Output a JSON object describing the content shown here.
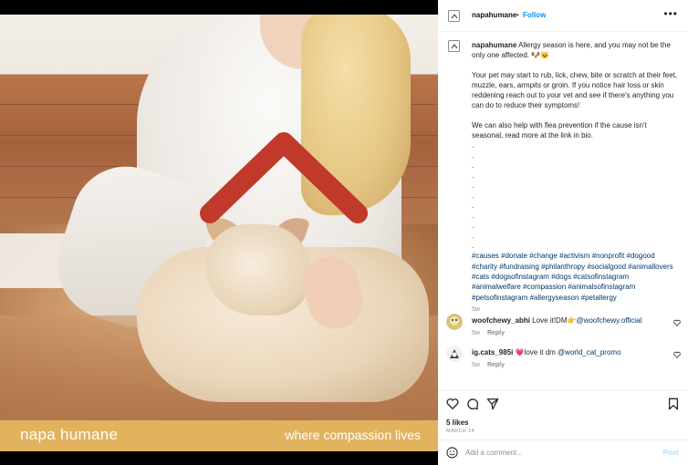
{
  "post_image": {
    "brand": "napa humane",
    "tagline": "where compassion lives"
  },
  "header": {
    "username": "napahumane",
    "separator": "•",
    "follow_label": "Follow",
    "more_label": "•••"
  },
  "caption": {
    "username": "napahumane",
    "text1": "Allergy season is here, and you may not be the only one affected. 🐶🐱",
    "text2": "Your pet may start to rub, lick, chew, bite or scratch at their feet, muzzle, ears, armpits or groin. If you notice hair loss or skin reddening reach out to your vet and see if there's anything you can do to reduce their symptoms!",
    "text3": "We can also help with flea prevention if the cause isn't seasonal, read more at the link in bio.",
    "dots": [
      ".",
      ".",
      ".",
      ".",
      ".",
      ".",
      ".",
      ".",
      ".",
      ".",
      "."
    ],
    "hashtags": [
      "#causes",
      "#donate",
      "#change",
      "#activism",
      "#nonprofit",
      "#dogood",
      "#charity",
      "#fundraising",
      "#philanthropy",
      "#socialgood",
      "#animallovers",
      "#cats",
      "#dogsofinstagram",
      "#dogs",
      "#catsofinstagram",
      "#animalwelfare",
      "#compassion",
      "#animalsofinstagram",
      "#petsofinstagram",
      "#allergyseason",
      "#petallergy"
    ],
    "time_ago": "5w"
  },
  "comments": [
    {
      "username": "woofchewy_abhi",
      "text": "Love it!DM👉",
      "mention": "@woofchewy.official",
      "time_ago": "5w",
      "reply": "Reply"
    },
    {
      "username": "ig.cats_985i",
      "text": "💗love it dm",
      "mention": "@world_cat_promo",
      "time_ago": "5w",
      "reply": "Reply"
    }
  ],
  "stats": {
    "likes": "5 likes",
    "date": "MARCH 14"
  },
  "comment_box": {
    "placeholder": "Add a comment...",
    "post_label": "Post"
  },
  "colors": {
    "link_blue": "#0095f6",
    "hashtag": "#00376b",
    "banner": "#e2b35f",
    "arrow": "#c0392b"
  }
}
